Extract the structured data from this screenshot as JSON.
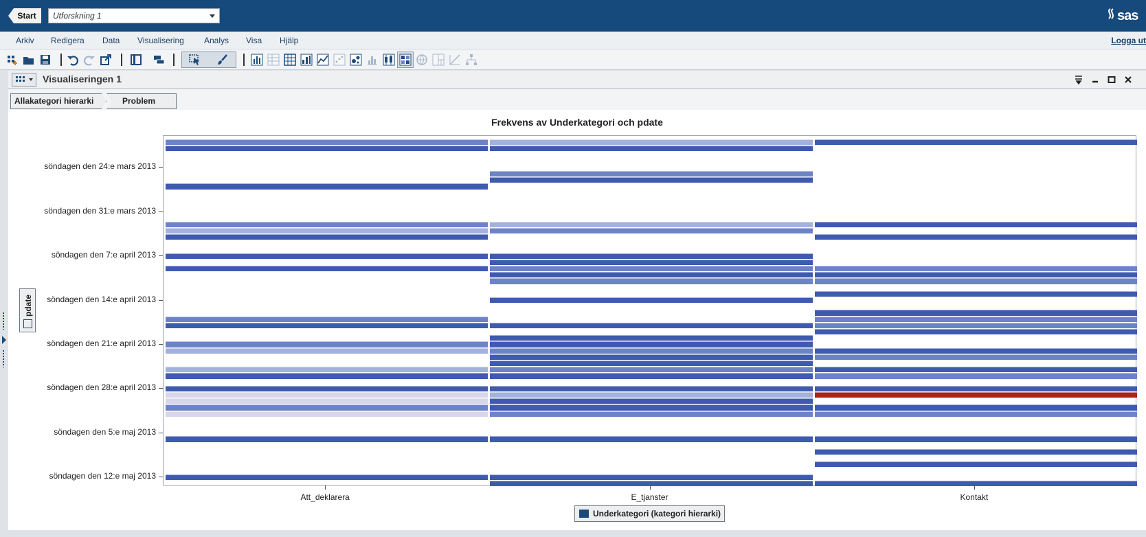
{
  "topbar": {
    "start_label": "Start",
    "project_name": "Utforskning 1",
    "brand": "sas"
  },
  "menu": {
    "items": [
      "Arkiv",
      "Redigera",
      "Data",
      "Visualisering",
      "Analys",
      "Visa",
      "Hjälp"
    ],
    "logout": "Logga ut"
  },
  "toolbar": {
    "icons": [
      "new-data-icon",
      "open-icon",
      "save-icon",
      "undo-icon",
      "redo-icon",
      "export-icon",
      "columns-icon",
      "layers-icon",
      "select-icon",
      "brush-icon",
      "bar-chart-icon",
      "table-icon",
      "crosstab-icon",
      "column-chart-icon",
      "line-chart-icon",
      "scatter-icon",
      "bubble-icon",
      "histogram-icon",
      "box-plot-icon",
      "heatmap-icon",
      "geo-map-icon",
      "treemap-icon",
      "correlation-icon",
      "network-icon"
    ]
  },
  "panel": {
    "title": "Visualiseringen 1"
  },
  "breadcrumb": {
    "items": [
      "Allakategori hierarki",
      "Problem"
    ]
  },
  "roles": {
    "x": "Underkategori (kategori hierarki)",
    "y": "pdate"
  },
  "colors": {
    "high": "#3f5bb0",
    "medium": "#6c83c8",
    "low": "#a3b2dd",
    "very_low": "#d9d5ea",
    "peak": "#a6261c"
  },
  "chart_data": {
    "type": "heatmap",
    "title": "Frekvens av Underkategori och pdate",
    "categories": [
      "Att_deklarera",
      "E_tjanster",
      "Kontakt"
    ],
    "y_ticks": [
      "söndagen den 24:e mars 2013",
      "söndagen den 31:e mars 2013",
      "söndagen den 7:e april 2013",
      "söndagen den 14:e april 2013",
      "söndagen den 21:e april 2013",
      "söndagen den 28:e april 2013",
      "söndagen den 5:e maj 2013",
      "söndagen den 12:e maj 2013"
    ],
    "y_start": "2013-03-20",
    "y_end": "2013-05-15",
    "cells": [
      {
        "category": "Att_deklarera",
        "date": "2013-03-20",
        "level": "medium"
      },
      {
        "category": "Att_deklarera",
        "date": "2013-03-21",
        "level": "high"
      },
      {
        "category": "Att_deklarera",
        "date": "2013-03-27",
        "level": "high"
      },
      {
        "category": "Att_deklarera",
        "date": "2013-04-02",
        "level": "medium"
      },
      {
        "category": "Att_deklarera",
        "date": "2013-04-03",
        "level": "low"
      },
      {
        "category": "Att_deklarera",
        "date": "2013-04-04",
        "level": "high"
      },
      {
        "category": "Att_deklarera",
        "date": "2013-04-07",
        "level": "high"
      },
      {
        "category": "Att_deklarera",
        "date": "2013-04-09",
        "level": "high"
      },
      {
        "category": "Att_deklarera",
        "date": "2013-04-17",
        "level": "medium"
      },
      {
        "category": "Att_deklarera",
        "date": "2013-04-18",
        "level": "high"
      },
      {
        "category": "Att_deklarera",
        "date": "2013-04-21",
        "level": "medium"
      },
      {
        "category": "Att_deklarera",
        "date": "2013-04-22",
        "level": "low"
      },
      {
        "category": "Att_deklarera",
        "date": "2013-04-25",
        "level": "low"
      },
      {
        "category": "Att_deklarera",
        "date": "2013-04-26",
        "level": "high"
      },
      {
        "category": "Att_deklarera",
        "date": "2013-04-28",
        "level": "high"
      },
      {
        "category": "Att_deklarera",
        "date": "2013-04-29",
        "level": "very_low"
      },
      {
        "category": "Att_deklarera",
        "date": "2013-04-30",
        "level": "very_low"
      },
      {
        "category": "Att_deklarera",
        "date": "2013-05-01",
        "level": "medium"
      },
      {
        "category": "Att_deklarera",
        "date": "2013-05-02",
        "level": "very_low"
      },
      {
        "category": "Att_deklarera",
        "date": "2013-05-06",
        "level": "high"
      },
      {
        "category": "Att_deklarera",
        "date": "2013-05-12",
        "level": "high"
      },
      {
        "category": "E_tjanster",
        "date": "2013-03-20",
        "level": "low"
      },
      {
        "category": "E_tjanster",
        "date": "2013-03-21",
        "level": "high"
      },
      {
        "category": "E_tjanster",
        "date": "2013-03-25",
        "level": "medium"
      },
      {
        "category": "E_tjanster",
        "date": "2013-03-26",
        "level": "high"
      },
      {
        "category": "E_tjanster",
        "date": "2013-04-02",
        "level": "low"
      },
      {
        "category": "E_tjanster",
        "date": "2013-04-03",
        "level": "medium"
      },
      {
        "category": "E_tjanster",
        "date": "2013-04-07",
        "level": "high"
      },
      {
        "category": "E_tjanster",
        "date": "2013-04-08",
        "level": "high"
      },
      {
        "category": "E_tjanster",
        "date": "2013-04-09",
        "level": "medium"
      },
      {
        "category": "E_tjanster",
        "date": "2013-04-10",
        "level": "high"
      },
      {
        "category": "E_tjanster",
        "date": "2013-04-11",
        "level": "medium"
      },
      {
        "category": "E_tjanster",
        "date": "2013-04-14",
        "level": "high"
      },
      {
        "category": "E_tjanster",
        "date": "2013-04-18",
        "level": "high"
      },
      {
        "category": "E_tjanster",
        "date": "2013-04-20",
        "level": "high"
      },
      {
        "category": "E_tjanster",
        "date": "2013-04-21",
        "level": "high"
      },
      {
        "category": "E_tjanster",
        "date": "2013-04-22",
        "level": "medium"
      },
      {
        "category": "E_tjanster",
        "date": "2013-04-23",
        "level": "high"
      },
      {
        "category": "E_tjanster",
        "date": "2013-04-24",
        "level": "high"
      },
      {
        "category": "E_tjanster",
        "date": "2013-04-25",
        "level": "medium"
      },
      {
        "category": "E_tjanster",
        "date": "2013-04-26",
        "level": "high"
      },
      {
        "category": "E_tjanster",
        "date": "2013-04-28",
        "level": "high"
      },
      {
        "category": "E_tjanster",
        "date": "2013-04-29",
        "level": "low"
      },
      {
        "category": "E_tjanster",
        "date": "2013-04-30",
        "level": "high"
      },
      {
        "category": "E_tjanster",
        "date": "2013-05-01",
        "level": "high"
      },
      {
        "category": "E_tjanster",
        "date": "2013-05-02",
        "level": "medium"
      },
      {
        "category": "E_tjanster",
        "date": "2013-05-06",
        "level": "high"
      },
      {
        "category": "E_tjanster",
        "date": "2013-05-12",
        "level": "high"
      },
      {
        "category": "E_tjanster",
        "date": "2013-05-13",
        "level": "high"
      },
      {
        "category": "Kontakt",
        "date": "2013-03-20",
        "level": "high"
      },
      {
        "category": "Kontakt",
        "date": "2013-04-02",
        "level": "high"
      },
      {
        "category": "Kontakt",
        "date": "2013-04-04",
        "level": "high"
      },
      {
        "category": "Kontakt",
        "date": "2013-04-09",
        "level": "medium"
      },
      {
        "category": "Kontakt",
        "date": "2013-04-10",
        "level": "high"
      },
      {
        "category": "Kontakt",
        "date": "2013-04-11",
        "level": "medium"
      },
      {
        "category": "Kontakt",
        "date": "2013-04-13",
        "level": "high"
      },
      {
        "category": "Kontakt",
        "date": "2013-04-16",
        "level": "high"
      },
      {
        "category": "Kontakt",
        "date": "2013-04-17",
        "level": "medium"
      },
      {
        "category": "Kontakt",
        "date": "2013-04-18",
        "level": "medium"
      },
      {
        "category": "Kontakt",
        "date": "2013-04-19",
        "level": "high"
      },
      {
        "category": "Kontakt",
        "date": "2013-04-22",
        "level": "high"
      },
      {
        "category": "Kontakt",
        "date": "2013-04-23",
        "level": "medium"
      },
      {
        "category": "Kontakt",
        "date": "2013-04-25",
        "level": "high"
      },
      {
        "category": "Kontakt",
        "date": "2013-04-26",
        "level": "medium"
      },
      {
        "category": "Kontakt",
        "date": "2013-04-28",
        "level": "high"
      },
      {
        "category": "Kontakt",
        "date": "2013-04-29",
        "level": "peak"
      },
      {
        "category": "Kontakt",
        "date": "2013-05-01",
        "level": "high"
      },
      {
        "category": "Kontakt",
        "date": "2013-05-02",
        "level": "medium"
      },
      {
        "category": "Kontakt",
        "date": "2013-05-06",
        "level": "high"
      },
      {
        "category": "Kontakt",
        "date": "2013-05-08",
        "level": "high"
      },
      {
        "category": "Kontakt",
        "date": "2013-05-10",
        "level": "high"
      },
      {
        "category": "Kontakt",
        "date": "2013-05-13",
        "level": "high"
      }
    ]
  }
}
